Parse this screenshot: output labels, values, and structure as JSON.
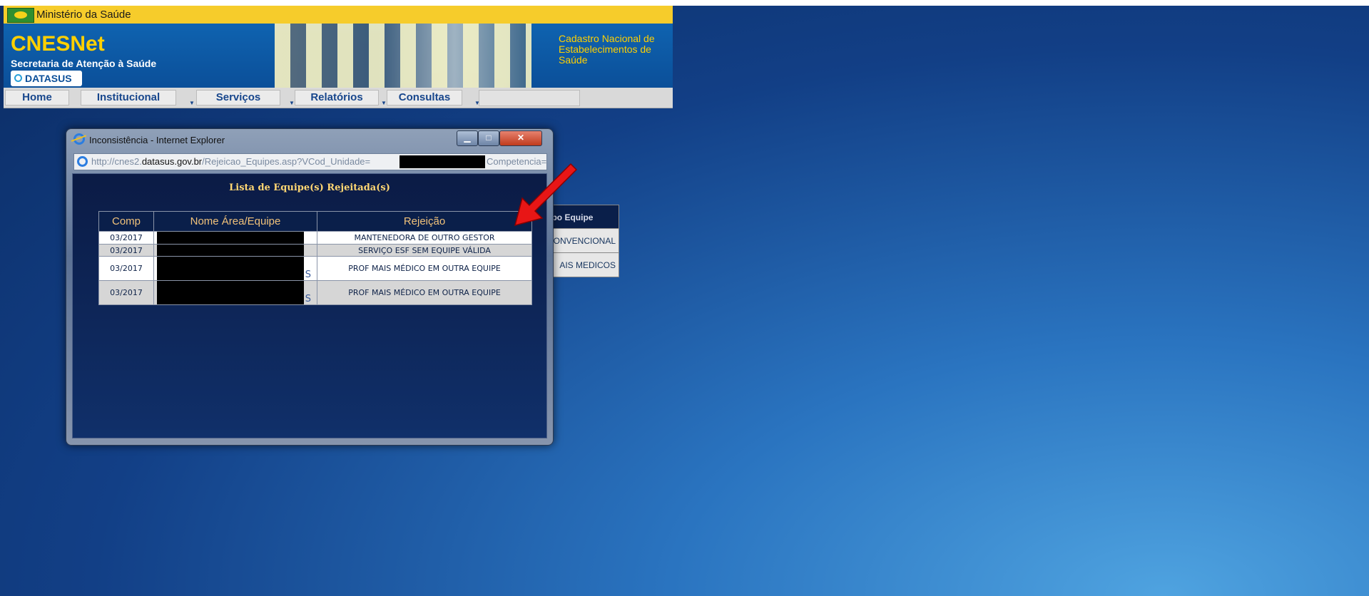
{
  "portal": {
    "ministry_label": "Ministério da Saúde",
    "logo_title": "CNESNet",
    "logo_subtitle": "Secretaria de Atenção à Saúde",
    "datasus_label": "DATASUS",
    "tagline": "Cadastro Nacional de Estabelecimentos de Saúde"
  },
  "menu": {
    "items": [
      {
        "label": "Home"
      },
      {
        "label": "Institucional"
      },
      {
        "label": "Serviços"
      },
      {
        "label": "Relatórios"
      },
      {
        "label": "Consultas"
      }
    ]
  },
  "background_table": {
    "header": "ib Tipo Equipe",
    "rows": [
      "ONVENCIONAL",
      "AIS MEDICOS"
    ]
  },
  "popup": {
    "window_title": "Inconsistência - Internet Explorer",
    "url_prefix": "http://cnes2.",
    "url_domain": "datasus.gov.br",
    "url_path": "/Rejeicao_Equipes.asp?VCod_Unidade=",
    "url_tail": "Competencia=",
    "list_title": "Lista de Equipe(s) Rejeitada(s)",
    "columns": [
      "Comp",
      "Nome Área/Equipe",
      "Rejeição"
    ],
    "rows": [
      {
        "comp": "03/2017",
        "rejeicao": "MANTENEDORA DE OUTRO GESTOR"
      },
      {
        "comp": "03/2017",
        "rejeicao": "SERVIÇO ESF SEM EQUIPE VÁLIDA"
      },
      {
        "comp": "03/2017",
        "rejeicao": "PROF MAIS MÉDICO EM OUTRA EQUIPE",
        "tail": "S"
      },
      {
        "comp": "03/2017",
        "rejeicao": "PROF MAIS MÉDICO EM OUTRA EQUIPE",
        "tail": "S"
      }
    ]
  },
  "colors": {
    "arrow": "#e81616",
    "header_yellow": "#f6cc2b",
    "banner_blue": "#0b4f99"
  },
  "icons": [
    "ie-icon",
    "minimize-icon",
    "maximize-icon",
    "close-icon",
    "red-arrow-annotation"
  ]
}
